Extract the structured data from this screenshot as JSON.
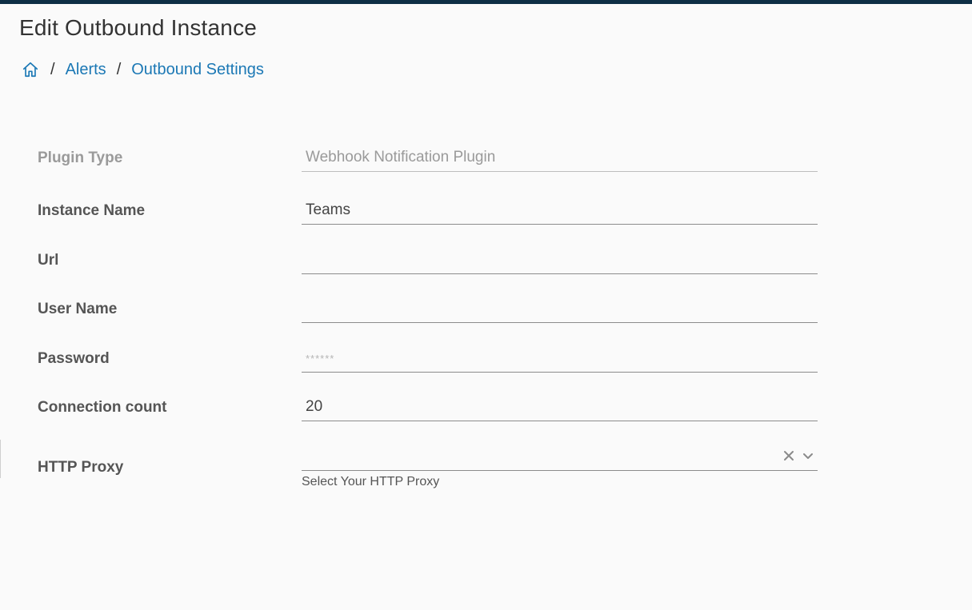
{
  "header": {
    "title": "Edit Outbound Instance"
  },
  "breadcrumb": {
    "home_icon": "home-icon",
    "separator": "/",
    "items": [
      {
        "label": "Alerts"
      },
      {
        "label": "Outbound Settings"
      }
    ]
  },
  "colors": {
    "top_bar": "#0e2f45",
    "link": "#1b78b5"
  },
  "form": {
    "plugin_type": {
      "label": "Plugin Type",
      "value": "Webhook Notification Plugin"
    },
    "instance_name": {
      "label": "Instance Name",
      "value": "Teams"
    },
    "url": {
      "label": "Url",
      "value": ""
    },
    "user_name": {
      "label": "User Name",
      "value": ""
    },
    "password": {
      "label": "Password",
      "value": "",
      "placeholder": "******"
    },
    "connection_count": {
      "label": "Connection count",
      "value": "20"
    },
    "http_proxy": {
      "label": "HTTP Proxy",
      "value": "",
      "hint": "Select Your HTTP Proxy",
      "clear_icon": "close-icon",
      "dropdown_icon": "chevron-down-icon"
    }
  }
}
